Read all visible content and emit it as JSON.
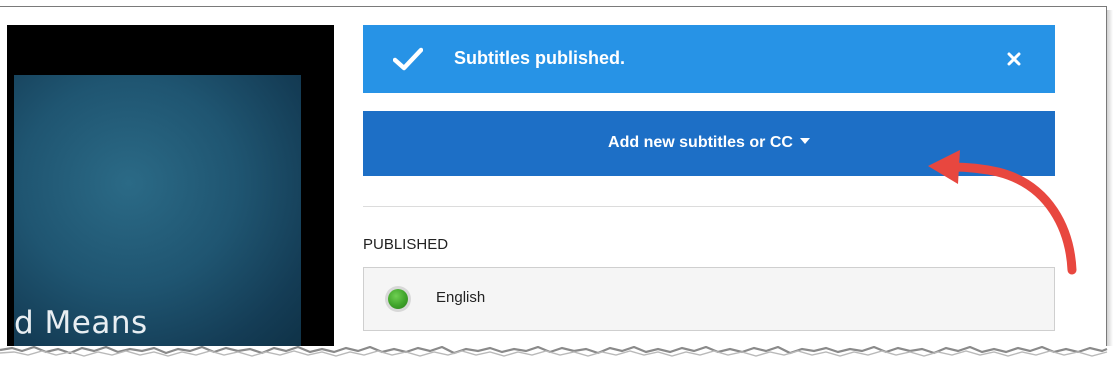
{
  "video": {
    "slide_text": "d Means"
  },
  "notice": {
    "message": "Subtitles published.",
    "check_icon": "checkmark-icon",
    "close_icon": "close-icon"
  },
  "add_subtitles": {
    "label": "Add new subtitles or CC",
    "icon": "caret-down-icon"
  },
  "published": {
    "heading": "PUBLISHED",
    "languages": [
      {
        "name": "English",
        "status_color": "#3fa32a"
      }
    ]
  },
  "colors": {
    "notice_bg": "#2793e6",
    "button_bg": "#1d6fc6",
    "annotation_arrow": "#e8473f"
  }
}
